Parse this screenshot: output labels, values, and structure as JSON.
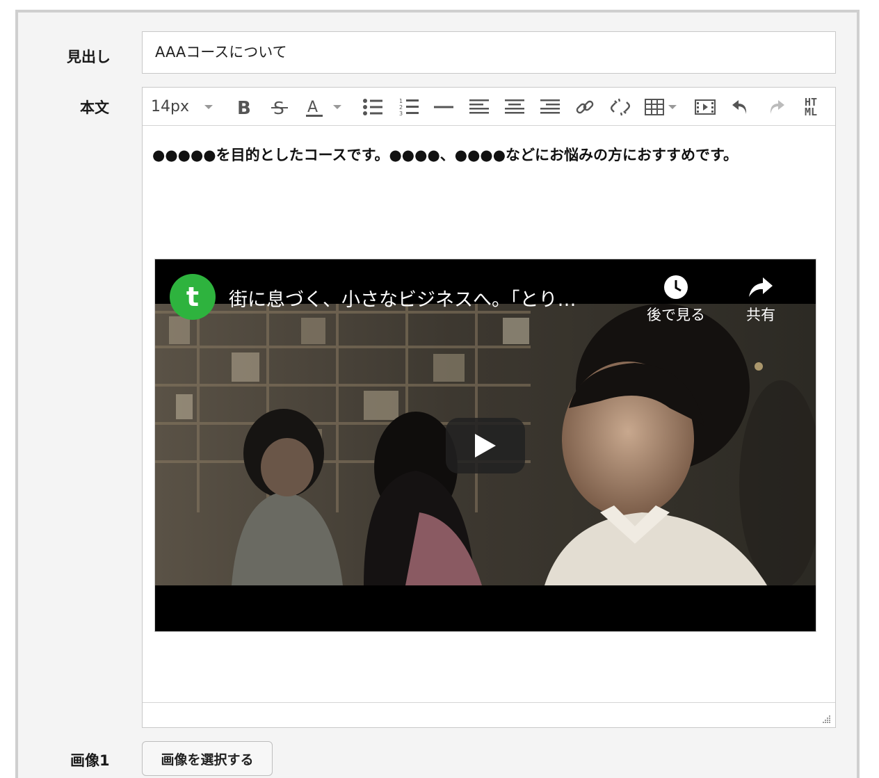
{
  "form": {
    "heading_label": "見出し",
    "heading_value": "AAAコースについて",
    "body_label": "本文",
    "image1_label": "画像1",
    "image1_button": "画像を選択する"
  },
  "toolbar": {
    "font_size": "14px",
    "buttons": [
      "bold",
      "strikethrough",
      "text-color",
      "bullet-list",
      "numbered-list",
      "horizontal-rule",
      "align-left",
      "align-center",
      "align-right",
      "link",
      "unlink",
      "table",
      "video",
      "undo",
      "redo",
      "html"
    ],
    "html_label_top": "HT",
    "html_label_bottom": "ML"
  },
  "editor": {
    "paragraph": "●●●●●を目的としたコースです。●●●●、●●●●などにお悩みの方におすすめです。"
  },
  "video": {
    "channel_initial": "t",
    "title": "街に息づく、小さなビジネスへ。「とり…",
    "watch_later": "後で見る",
    "share": "共有",
    "channel_color": "#2eb33e"
  }
}
